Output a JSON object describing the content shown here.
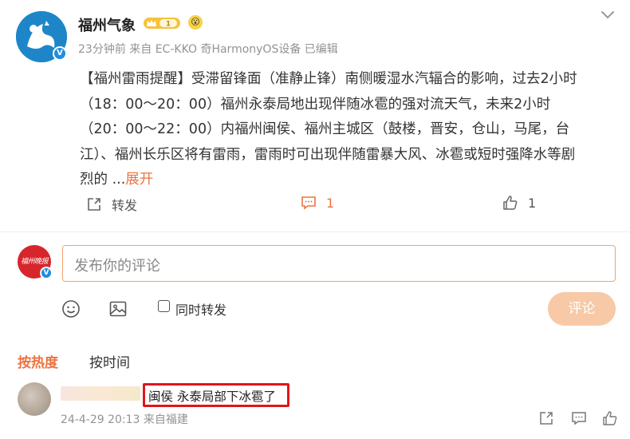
{
  "post": {
    "author": "福州气象",
    "level_badge": "1",
    "emoji_badge": "😮",
    "meta": "23分钟前 来自 EC-KKO 奇HarmonyOS设备 已编辑",
    "content_lines": [
      "【福州雷雨提醒】受滞留锋面（准静止锋）南侧暖湿水汽辐合的影响，过去2小时",
      "（18：00～20：00）福州永泰局地出现伴随冰雹的强对流天气，未来2小时",
      "（20：00～22：00）内福州闽侯、福州主城区（鼓楼，晋安，仓山，马尾，台",
      "江）、福州长乐区将有雷雨，雷雨时可出现伴随雷暴大风、冰雹或短时强降水等剧",
      "烈的 ..."
    ],
    "expand_label": "展开",
    "actions": {
      "repost_label": "转发",
      "comment_count": "1",
      "like_count": "1"
    }
  },
  "composer": {
    "avatar_text": "福州晚报",
    "placeholder": "发布你的评论",
    "repost_label": "同时转发",
    "submit_label": "评论"
  },
  "sort": {
    "hot_label": "按热度",
    "time_label": "按时间"
  },
  "comments": [
    {
      "text": "闽侯 永泰局部下冰雹了",
      "meta": "24-4-29 20:13 来自福建"
    }
  ],
  "colors": {
    "accent": "#eb7340",
    "verified": "#1e8ee0",
    "highlight": "#e0151c",
    "disabled_button": "#f7c9a6"
  }
}
